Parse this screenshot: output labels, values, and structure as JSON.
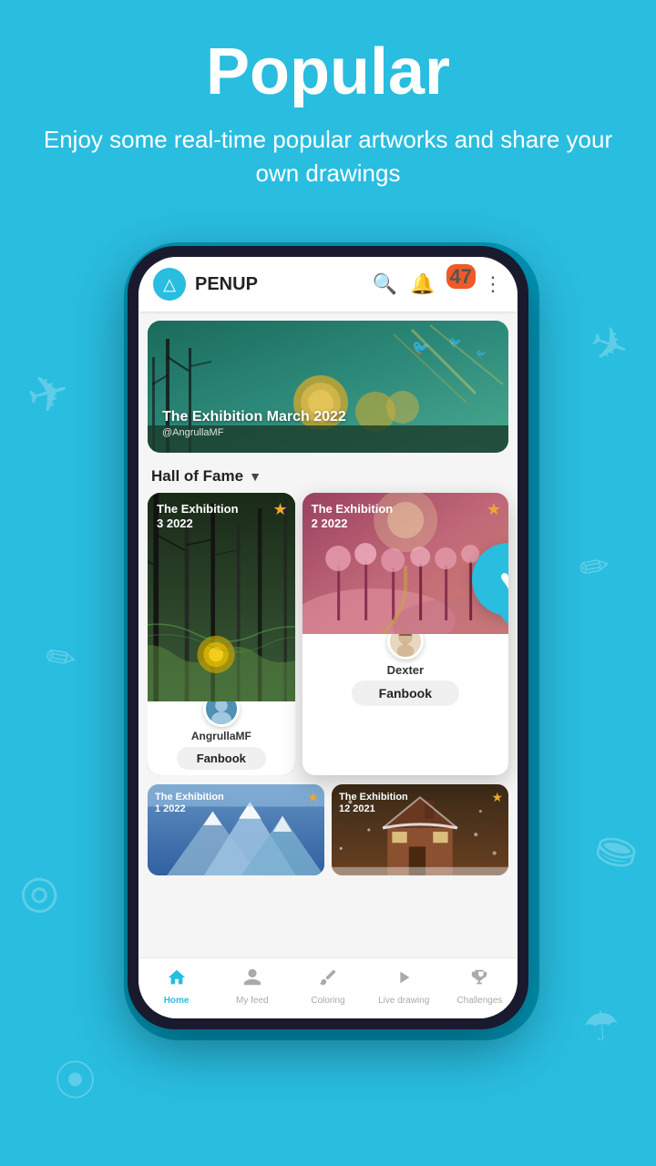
{
  "background_color": "#29bde0",
  "header": {
    "title": "Popular",
    "subtitle": "Enjoy some real-time popular artworks and share your own drawings"
  },
  "app": {
    "name": "PENUP",
    "logo_symbol": "△",
    "notification_count": "47"
  },
  "banner": {
    "title": "The Exhibition March 2022",
    "author": "@AngrullaMF",
    "star": "★"
  },
  "section": {
    "title": "Hall of Fame",
    "arrow": "▼"
  },
  "card_left": {
    "title": "The Exhibition\n3 2022",
    "username": "AngrullaMF",
    "fanbook_label": "Fanbook",
    "star": "★"
  },
  "card_right": {
    "title": "The Exhibition\n2 2022",
    "username": "Dexter",
    "fanbook_label": "Fanbook",
    "star": "★"
  },
  "bottom_cards": [
    {
      "title": "The Exhibition\n1 2022",
      "star": "★",
      "theme": "mountain"
    },
    {
      "title": "The Exhibition\n12 2021",
      "star": "★",
      "theme": "house"
    }
  ],
  "nav": {
    "items": [
      {
        "label": "Home",
        "icon": "⌂",
        "active": true
      },
      {
        "label": "My feed",
        "icon": "👤",
        "active": false
      },
      {
        "label": "Coloring",
        "icon": "🎨",
        "active": false
      },
      {
        "label": "Live drawing",
        "icon": "▶",
        "active": false
      },
      {
        "label": "Challenges",
        "icon": "🏆",
        "active": false
      }
    ]
  },
  "icons": {
    "search": "🔍",
    "bell": "🔔",
    "more": "⋮",
    "heart": "♥",
    "star": "★",
    "home": "⌂",
    "person": "👤",
    "palette": "🎨",
    "play": "▶",
    "trophy": "🏆"
  }
}
